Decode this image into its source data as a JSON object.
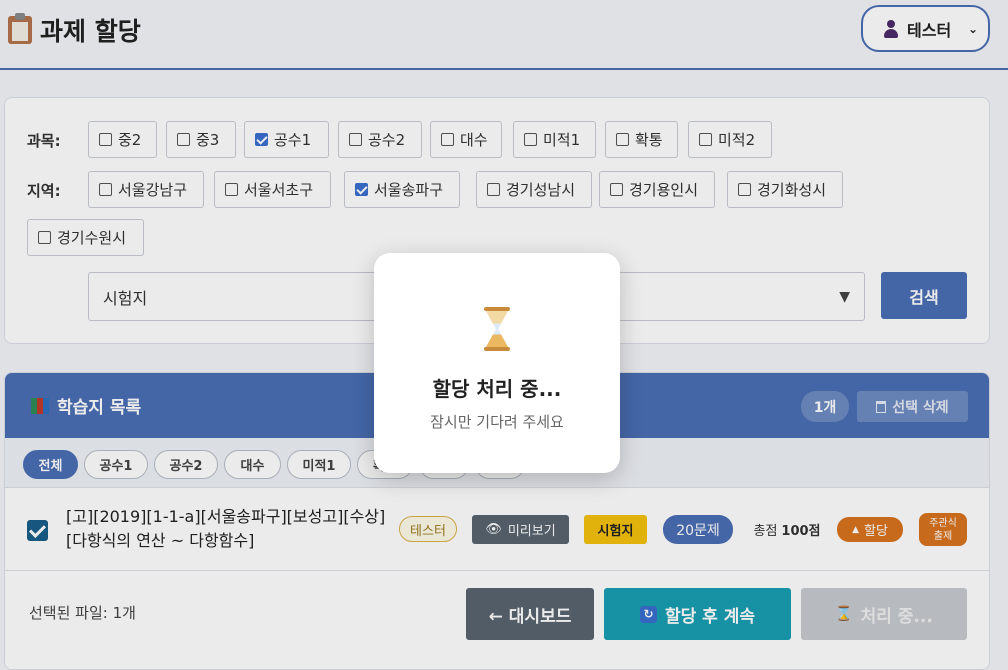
{
  "header": {
    "title": "과제 할당",
    "user_label": "테스터",
    "user_chevron": "⌄"
  },
  "filters": {
    "subject_label": "과목:",
    "subjects": [
      {
        "label": "중2",
        "checked": false
      },
      {
        "label": "중3",
        "checked": false
      },
      {
        "label": "공수1",
        "checked": true
      },
      {
        "label": "공수2",
        "checked": false
      },
      {
        "label": "대수",
        "checked": false
      },
      {
        "label": "미적1",
        "checked": false
      },
      {
        "label": "확통",
        "checked": false
      },
      {
        "label": "미적2",
        "checked": false
      }
    ],
    "region_label": "지역:",
    "regions": [
      {
        "label": "서울강남구",
        "checked": false
      },
      {
        "label": "서울서초구",
        "checked": false
      },
      {
        "label": "서울송파구",
        "checked": true
      },
      {
        "label": "경기성남시",
        "checked": false
      },
      {
        "label": "경기용인시",
        "checked": false
      },
      {
        "label": "경기화성시",
        "checked": false
      },
      {
        "label": "경기수원시",
        "checked": false
      }
    ],
    "type_select_value": "시험지",
    "search_label": "검색"
  },
  "panel": {
    "title": "학습지 목록",
    "count": "1개",
    "delete_label": "선택 삭제",
    "tabs": [
      "전체",
      "공수1",
      "공수2",
      "대수",
      "미적1",
      "확통",
      "",
      ""
    ],
    "file": {
      "name_line1": "[고][2019][1-1-a][서울송파구][보성고][수상]",
      "name_line2": "[다항식의 연산 ~ 다항함수]",
      "owner": "테스터",
      "preview_label": "미리보기",
      "type_label": "시험지",
      "problems": "20문제",
      "score_prefix": "총점",
      "score": "100점",
      "assign_label": "할당",
      "subjective_line1": "주관식",
      "subjective_line2": "출제"
    },
    "footer": {
      "selected_text": "선택된 파일: 1개",
      "dashboard_label": "← 대시보드",
      "assign_continue_label": "할당 후 계속",
      "processing_label": "처리 중..."
    }
  },
  "modal": {
    "title": "할당 처리 중...",
    "subtitle": "잠시만 기다려 주세요"
  },
  "colors": {
    "accent": "#4a6fb5",
    "teal": "#1a9fb3",
    "yellow": "#f4c20d",
    "orange": "#d9731e"
  }
}
